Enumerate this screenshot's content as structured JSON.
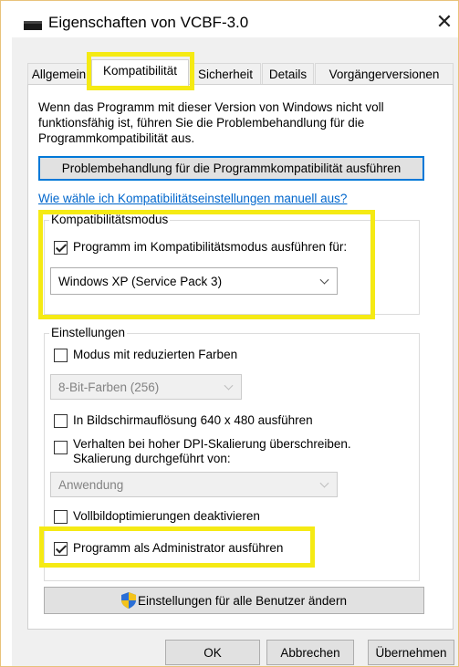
{
  "window": {
    "title": "Eigenschaften von VCBF-3.0"
  },
  "tabs": [
    {
      "label": "Allgemein"
    },
    {
      "label": "Kompatibilität"
    },
    {
      "label": "Sicherheit"
    },
    {
      "label": "Details"
    },
    {
      "label": "Vorgängerversionen"
    }
  ],
  "active_tab": "Kompatibilität",
  "description": "Wenn das Programm mit dieser Version von Windows nicht voll funktionsfähig ist, führen Sie die Problembehandlung für die Programmkompatibilität aus.",
  "troubleshoot_button": "Problembehandlung für die Programmkompatibilität ausführen",
  "manual_link": "Wie wähle ich Kompatibilitätseinstellungen manuell aus?",
  "compat_mode": {
    "group_label": "Kompatibilitätsmodus",
    "checkbox_label": "Programm im Kompatibilitätsmodus ausführen für:",
    "checked": true,
    "selected_os": "Windows XP (Service Pack 3)"
  },
  "settings": {
    "group_label": "Einstellungen",
    "reduced_colors": {
      "label": "Modus mit reduzierten Farben",
      "checked": false
    },
    "color_select": "8-Bit-Farben (256)",
    "resolution": {
      "label": "In Bildschirmauflösung 640 x 480 ausführen",
      "checked": false
    },
    "dpi_override": {
      "label_line1": "Verhalten bei hoher DPI-Skalierung überschreiben.",
      "label_line2": "Skalierung durchgeführt von:",
      "checked": false
    },
    "dpi_select": "Anwendung",
    "fullscreen_opt": {
      "label": "Vollbildoptimierungen deaktivieren",
      "checked": false
    },
    "run_as_admin": {
      "label": "Programm als Administrator ausführen",
      "checked": true
    }
  },
  "all_users_button": "Einstellungen für alle Benutzer ändern",
  "footer": {
    "ok": "OK",
    "cancel": "Abbrechen",
    "apply": "Übernehmen"
  },
  "colors": {
    "highlight": "#f5ea14",
    "link": "#0066cc",
    "accent": "#0078d7",
    "shield_blue": "#2b6fd6",
    "shield_yellow": "#f3c31c"
  }
}
